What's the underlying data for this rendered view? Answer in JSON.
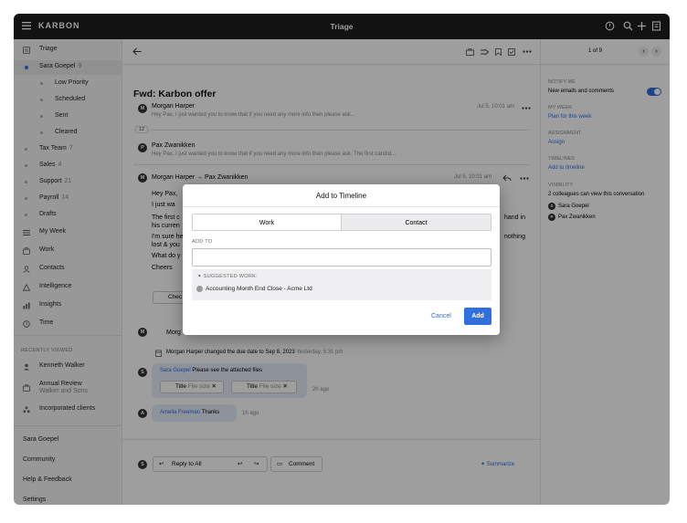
{
  "topbar": {
    "logo": "KARBON",
    "title": "Triage"
  },
  "sidebar": {
    "items": [
      {
        "label": "Triage",
        "count": "",
        "icon": "inbox-icon"
      },
      {
        "label": "Sara Goepel",
        "count": "9",
        "icon": "dot-blue"
      },
      {
        "label": "Low Priority",
        "count": "",
        "icon": "dot"
      },
      {
        "label": "Scheduled",
        "count": "",
        "icon": "dot"
      },
      {
        "label": "Sent",
        "count": "",
        "icon": "dot"
      },
      {
        "label": "Cleared",
        "count": "",
        "icon": "dot"
      },
      {
        "label": "Tax Team",
        "count": "7",
        "icon": "dot"
      },
      {
        "label": "Sales",
        "count": "4",
        "icon": "dot"
      },
      {
        "label": "Support",
        "count": "21",
        "icon": "dot"
      },
      {
        "label": "Payroll",
        "count": "14",
        "icon": "dot"
      },
      {
        "label": "Drafts",
        "count": "",
        "icon": "dot"
      },
      {
        "label": "My Week",
        "count": "",
        "icon": "list-icon"
      },
      {
        "label": "Work",
        "count": "",
        "icon": "briefcase-icon"
      },
      {
        "label": "Contacts",
        "count": "",
        "icon": "contacts-icon"
      },
      {
        "label": "Intelligence",
        "count": "",
        "icon": "triangle-icon"
      },
      {
        "label": "Insights",
        "count": "",
        "icon": "bar-chart-icon"
      },
      {
        "label": "Time",
        "count": "",
        "icon": "clock-icon"
      }
    ],
    "recently_viewed_label": "RECENTLY VIEWED",
    "recent": [
      {
        "label": "Kenneth Walker",
        "sub": ""
      },
      {
        "label": "Annual Review",
        "sub": "Walker and Sons"
      },
      {
        "label": "Incorporated clients",
        "sub": ""
      }
    ],
    "bottom": [
      "Sara Goepel",
      "Community",
      "Help & Feedback",
      "Settings"
    ]
  },
  "main": {
    "subject": "Fwd: Karbon offer",
    "messages": [
      {
        "from": "Morgan Harper",
        "preview": "Hey Pax, I just wanted you to know that if you need any more info then please ask...",
        "date": "Jul 5, 10:01 am"
      },
      {
        "collapsed_count": "12"
      },
      {
        "from": "Pax Zwanikken",
        "preview": "Hey Pax, I just wanted you to know that if you need any more info then please ask. The first candid...",
        "date": ""
      }
    ],
    "expanded": {
      "from": "Morgan Harper",
      "to": "Pax Zwanikken",
      "date": "Jul 5, 10:01 am",
      "lines": [
        "Hey Pax,",
        "I just wa",
        "The first c",
        "his curren",
        "I'm sure he",
        "lost & you",
        "What do y",
        "Cheers"
      ],
      "right_lines": [
        "hand in",
        "",
        "nothing",
        ""
      ],
      "chip": "Chec"
    },
    "activity": [
      {
        "actor": "Morg",
        "text": ""
      },
      {
        "actor": "Morgan Harper",
        "text": "changed the due date to Sep 8, 2023",
        "time": "Yesterday, 5:31 pm"
      }
    ],
    "comment1": {
      "actor": "Sara Goepel",
      "text": "Please see the attached files",
      "time": "2h ago",
      "files": [
        {
          "name": "Title",
          "size": "File size"
        },
        {
          "name": "Title",
          "size": "File size"
        }
      ]
    },
    "comment2": {
      "actor": "Amelia Freeman",
      "text": "Thanks",
      "time": "1h ago"
    },
    "reply_all": "Reply to All",
    "comment_btn": "Comment",
    "summarize": "Summarize",
    "pager": "1 of 9"
  },
  "right": {
    "notify_label": "NOTIFY ME",
    "notify_value": "New emails and comments",
    "myweek_label": "MY WEEK",
    "myweek_value": "Plan for this week",
    "assign_label": "ASSIGNMENT",
    "assign_value": "Assign",
    "timelines_label": "TIMELINES",
    "timelines_value": "Add to timeline",
    "visibility_label": "VISIBILITY",
    "visibility_value": "2 colleagues can view this conversation",
    "people": [
      "Sara Goepel",
      "Pax Zwanikken"
    ]
  },
  "modal": {
    "title": "Add to Timeline",
    "tab_work": "Work",
    "tab_contact": "Contact",
    "add_to_label": "ADD TO",
    "input_value": "",
    "suggested_label": "SUGGESTED WORK:",
    "suggested_item": "Accounting  Month End Close - Acme Ltd",
    "cancel": "Cancel",
    "add": "Add"
  },
  "colors": {
    "accent": "#2f6fde",
    "topbar": "#1d1d1f",
    "overlay": "rgba(0,0,0,0.38)"
  }
}
